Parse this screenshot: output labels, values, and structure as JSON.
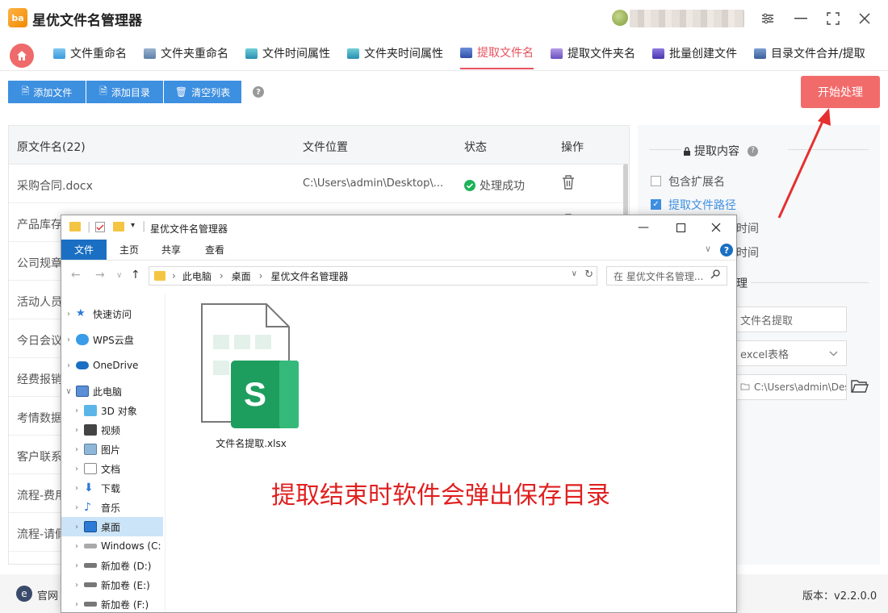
{
  "app": {
    "logo_text": "ba",
    "title": "星优文件名管理器",
    "window_buttons": [
      "settings",
      "minimize",
      "maximize",
      "close"
    ]
  },
  "tabs": [
    {
      "label": "文件重命名",
      "icon": "rename-icon",
      "active": false
    },
    {
      "label": "文件夹重命名",
      "icon": "folder-rename-icon",
      "active": false
    },
    {
      "label": "文件时间属性",
      "icon": "file-time-icon",
      "active": false
    },
    {
      "label": "文件夹时间属性",
      "icon": "folder-time-icon",
      "active": false
    },
    {
      "label": "提取文件名",
      "icon": "extract-filename-icon",
      "active": true
    },
    {
      "label": "提取文件夹名",
      "icon": "extract-folder-icon",
      "active": false
    },
    {
      "label": "批量创建文件",
      "icon": "batch-create-icon",
      "active": false
    },
    {
      "label": "目录文件合并/提取",
      "icon": "merge-icon",
      "active": false
    }
  ],
  "toolbar": {
    "add_file": "添加文件",
    "add_dir": "添加目录",
    "clear_list": "清空列表",
    "help": "?",
    "start": "开始处理"
  },
  "table": {
    "headers": [
      "原文件名(22)",
      "文件位置",
      "状态",
      "操作"
    ],
    "rows": [
      {
        "name": "采购合同.docx",
        "path": "C:\\Users\\admin\\Desktop\\...",
        "status": "处理成功"
      },
      {
        "name": "产品库存",
        "path": "",
        "status": ""
      },
      {
        "name": "公司规章",
        "path": "",
        "status": ""
      },
      {
        "name": "活动人员",
        "path": "",
        "status": ""
      },
      {
        "name": "今日会议",
        "path": "",
        "status": ""
      },
      {
        "name": "经费报销",
        "path": "",
        "status": ""
      },
      {
        "name": "考情数据",
        "path": "",
        "status": ""
      },
      {
        "name": "客户联系",
        "path": "",
        "status": ""
      },
      {
        "name": "流程-费用",
        "path": "",
        "status": ""
      },
      {
        "name": "流程-请假",
        "path": "",
        "status": ""
      }
    ]
  },
  "panel": {
    "section1_title": "提取内容",
    "options": [
      {
        "label": "包含扩展名",
        "checked": false
      },
      {
        "label": "提取文件路径",
        "checked": true
      },
      {
        "label": "时间",
        "checked": false
      },
      {
        "label": "时间",
        "checked": false
      }
    ],
    "section2_title": "理",
    "mode_value": "文件名提取",
    "format_value": "excel表格",
    "output_path": "C:\\Users\\admin\\Des"
  },
  "statusbar": {
    "website": "官网",
    "version": "版本：v2.2.0.0"
  },
  "explorer": {
    "title": "星优文件名管理器",
    "ribbon_tabs": [
      "文件",
      "主页",
      "共享",
      "查看"
    ],
    "path": [
      "此电脑",
      "桌面",
      "星优文件名管理器"
    ],
    "search_placeholder": "在 星优文件名管理...",
    "nav": [
      {
        "label": "快速访问",
        "icon": "star-icon"
      },
      {
        "label": "WPS云盘",
        "icon": "cloud-icon"
      },
      {
        "label": "OneDrive",
        "icon": "onedrive-icon"
      },
      {
        "label": "此电脑",
        "icon": "pc-icon"
      },
      {
        "label": "3D 对象",
        "icon": "3d-icon"
      },
      {
        "label": "视频",
        "icon": "video-icon"
      },
      {
        "label": "图片",
        "icon": "picture-icon"
      },
      {
        "label": "文档",
        "icon": "document-icon"
      },
      {
        "label": "下载",
        "icon": "download-icon"
      },
      {
        "label": "音乐",
        "icon": "music-icon"
      },
      {
        "label": "桌面",
        "icon": "desktop-icon",
        "selected": true
      },
      {
        "label": "Windows (C:",
        "icon": "drive-icon"
      },
      {
        "label": "新加卷 (D:)",
        "icon": "drive-icon"
      },
      {
        "label": "新加卷 (E:)",
        "icon": "drive-icon"
      },
      {
        "label": "新加卷 (F:)",
        "icon": "drive-icon"
      }
    ],
    "file_name": "文件名提取.xlsx",
    "file_badge": "S"
  },
  "annotation": "提取结束时软件会弹出保存目录",
  "colors": {
    "accent_red": "#e8505b",
    "button_blue": "#3d8fe0",
    "start_red": "#f26b6b",
    "success_green": "#1fb25a",
    "excel_green": "#1e9e5e"
  }
}
